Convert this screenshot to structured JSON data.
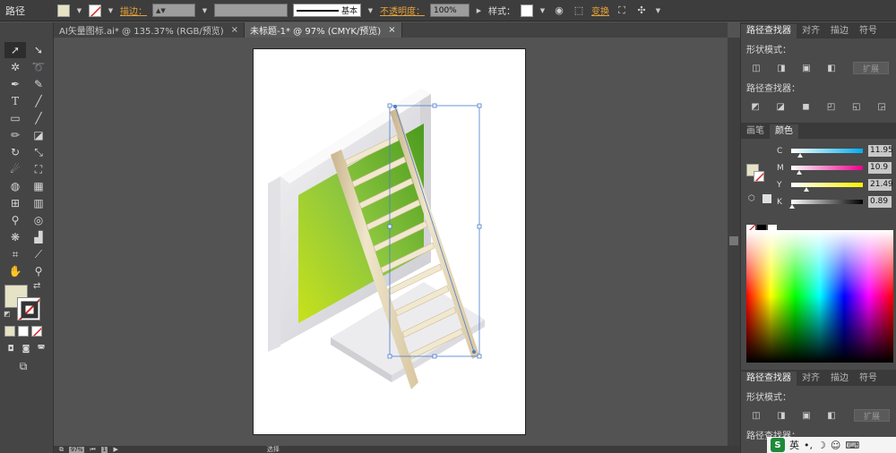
{
  "control_bar": {
    "object_type": "路径",
    "stroke_label": "描边：",
    "stroke_profile": "基本",
    "opacity_label": "不透明度：",
    "opacity_value": "100%",
    "style_label": "样式：",
    "transform_label": "变换",
    "fill_color": "#e6e2c5"
  },
  "tabs": [
    {
      "label": "AI矢量图标.ai* @ 135.37% (RGB/预览)",
      "close": "×"
    },
    {
      "label": "未标题-1* @ 97% (CMYK/预览)",
      "close": "×"
    }
  ],
  "status_bar": {
    "zoom": "97%",
    "page": "1",
    "selection": "选择"
  },
  "pathfinder_panel": {
    "tabs": [
      "路径查找器",
      "对齐",
      "描边",
      "符号"
    ],
    "shape_modes_label": "形状模式：",
    "pathfinders_label": "路径查找器：",
    "expand_label": "扩展"
  },
  "color_panel": {
    "tabs": [
      "画笔",
      "颜色"
    ],
    "channels": [
      {
        "label": "C",
        "value": "11.95",
        "fraction": 0.12,
        "color_from": "#ffffff",
        "color_to": "#00aeef"
      },
      {
        "label": "M",
        "value": "10.9",
        "fraction": 0.11,
        "color_from": "#ffffff",
        "color_to": "#ec008c"
      },
      {
        "label": "Y",
        "value": "21.49",
        "fraction": 0.21,
        "color_from": "#ffffff",
        "color_to": "#fff200"
      },
      {
        "label": "K",
        "value": "0.89",
        "fraction": 0.01,
        "color_from": "#ffffff",
        "color_to": "#000000"
      }
    ]
  },
  "pathfinder_panel_2": {
    "tabs": [
      "路径查找器",
      "对齐",
      "描边",
      "符号"
    ],
    "shape_modes_label": "形状模式：",
    "pathfinders_label": "路径查找器：",
    "expand_label": "扩展"
  },
  "ime_bar": {
    "logo": "S",
    "lang": "英"
  },
  "colors": {
    "screen_green": "#8cc63f",
    "ladder": "#e8dcbf",
    "accent_orange": "#e8a33a"
  }
}
